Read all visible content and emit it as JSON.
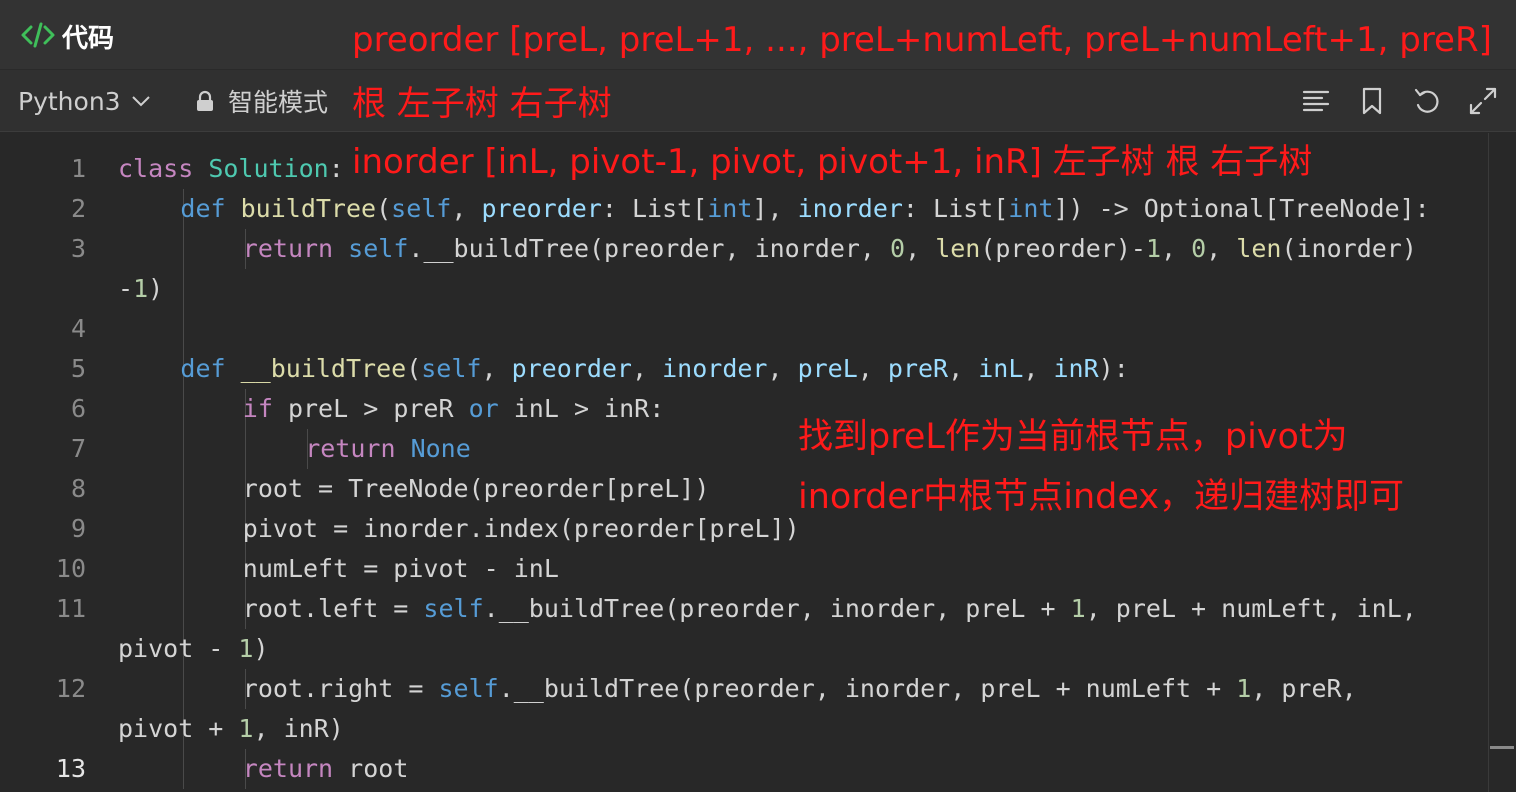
{
  "panel": {
    "title": "代码"
  },
  "toolbar": {
    "language": "Python3",
    "mode": "智能模式",
    "icons": [
      "format-icon",
      "bookmark-icon",
      "reset-icon",
      "fullscreen-icon"
    ]
  },
  "code": {
    "lines": [
      {
        "num": "1",
        "indent": 0,
        "tokens": [
          [
            "k",
            "class"
          ],
          [
            "",
            " "
          ],
          [
            "t",
            "Solution"
          ],
          [
            "",
            ":"
          ]
        ]
      },
      {
        "num": "2",
        "indent": 1,
        "tokens": [
          [
            "b",
            "def"
          ],
          [
            "",
            " "
          ],
          [
            "f",
            "buildTree"
          ],
          [
            "",
            "("
          ],
          [
            "b",
            "self"
          ],
          [
            "",
            ", "
          ],
          [
            "p",
            "preorder"
          ],
          [
            "",
            ": List["
          ],
          [
            "b",
            "int"
          ],
          [
            "",
            "], "
          ],
          [
            "p",
            "inorder"
          ],
          [
            "",
            ": List["
          ],
          [
            "b",
            "int"
          ],
          [
            "",
            "]) -> Optional[TreeNode]:"
          ]
        ]
      },
      {
        "num": "3",
        "indent": 2,
        "tokens": [
          [
            "k",
            "return"
          ],
          [
            "",
            " "
          ],
          [
            "b",
            "self"
          ],
          [
            "",
            ".__buildTree(preorder, inorder, "
          ],
          [
            "n",
            "0"
          ],
          [
            "",
            ", "
          ],
          [
            "f",
            "len"
          ],
          [
            "",
            "(preorder)-"
          ],
          [
            "n",
            "1"
          ],
          [
            "",
            ", "
          ],
          [
            "n",
            "0"
          ],
          [
            "",
            ", "
          ],
          [
            "f",
            "len"
          ],
          [
            "",
            "(inorder)"
          ]
        ]
      },
      {
        "num": "",
        "indent": 0,
        "tokens": [
          [
            "",
            "-"
          ],
          [
            "n",
            "1"
          ],
          [
            "",
            ")"
          ]
        ]
      },
      {
        "num": "4",
        "indent": 0,
        "tokens": []
      },
      {
        "num": "5",
        "indent": 1,
        "tokens": [
          [
            "b",
            "def"
          ],
          [
            "",
            " "
          ],
          [
            "f",
            "__buildTree"
          ],
          [
            "",
            "("
          ],
          [
            "b",
            "self"
          ],
          [
            "",
            ", "
          ],
          [
            "p",
            "preorder"
          ],
          [
            "",
            ", "
          ],
          [
            "p",
            "inorder"
          ],
          [
            "",
            ", "
          ],
          [
            "p",
            "preL"
          ],
          [
            "",
            ", "
          ],
          [
            "p",
            "preR"
          ],
          [
            "",
            ", "
          ],
          [
            "p",
            "inL"
          ],
          [
            "",
            ", "
          ],
          [
            "p",
            "inR"
          ],
          [
            "",
            "):"
          ]
        ]
      },
      {
        "num": "6",
        "indent": 2,
        "tokens": [
          [
            "k",
            "if"
          ],
          [
            "",
            " preL > preR "
          ],
          [
            "b",
            "or"
          ],
          [
            "",
            " inL > inR:"
          ]
        ]
      },
      {
        "num": "7",
        "indent": 3,
        "tokens": [
          [
            "k",
            "return"
          ],
          [
            "",
            " "
          ],
          [
            "b",
            "None"
          ]
        ]
      },
      {
        "num": "8",
        "indent": 2,
        "tokens": [
          [
            "",
            "root = TreeNode(preorder[preL])"
          ]
        ]
      },
      {
        "num": "9",
        "indent": 2,
        "tokens": [
          [
            "",
            "pivot = inorder.index(preorder[preL])"
          ]
        ]
      },
      {
        "num": "10",
        "indent": 2,
        "tokens": [
          [
            "",
            "numLeft = pivot - inL"
          ]
        ]
      },
      {
        "num": "11",
        "indent": 2,
        "tokens": [
          [
            "",
            "root.left = "
          ],
          [
            "b",
            "self"
          ],
          [
            "",
            ".__buildTree(preorder, inorder, preL + "
          ],
          [
            "n",
            "1"
          ],
          [
            "",
            ", preL + numLeft, inL,"
          ]
        ]
      },
      {
        "num": "",
        "indent": 0,
        "tokens": [
          [
            "",
            "pivot - "
          ],
          [
            "n",
            "1"
          ],
          [
            "",
            ")"
          ]
        ]
      },
      {
        "num": "12",
        "indent": 2,
        "tokens": [
          [
            "",
            "root.right = "
          ],
          [
            "b",
            "self"
          ],
          [
            "",
            ".__buildTree(preorder, inorder, preL + numLeft + "
          ],
          [
            "n",
            "1"
          ],
          [
            "",
            ", preR,"
          ]
        ]
      },
      {
        "num": "",
        "indent": 0,
        "tokens": [
          [
            "",
            "pivot + "
          ],
          [
            "n",
            "1"
          ],
          [
            "",
            ", inR)"
          ]
        ]
      },
      {
        "num": "13",
        "indent": 2,
        "active": true,
        "tokens": [
          [
            "k",
            "return"
          ],
          [
            "",
            " root"
          ]
        ]
      }
    ]
  },
  "annotations": {
    "line1": "preorder [preL, preL+1, ..., preL+numLeft, preL+numLeft+1, preR]",
    "line2": "根 左子树 右子树",
    "line3": "inorder [inL, pivot-1, pivot, pivot+1, inR] 左子树 根 右子树",
    "note1": "找到preL作为当前根节点，pivot为",
    "note2": "inorder中根节点index，递归建树即可"
  },
  "colors": {
    "background": "#282828",
    "keyword": "#c586c0",
    "builtin": "#569cd6",
    "class": "#4ec9b0",
    "function": "#dcdcaa",
    "param": "#9cdcfe",
    "number": "#b5cea8",
    "annotation": "#ff1a1a",
    "title_icon": "#3fbf5a"
  }
}
